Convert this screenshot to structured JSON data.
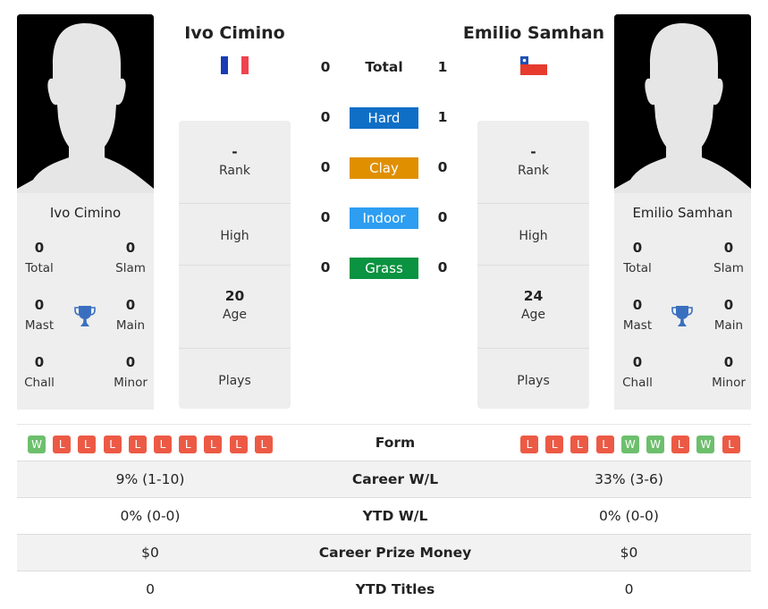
{
  "player1": {
    "name": "Ivo Cimino",
    "country_flag": "france-flag",
    "titles": {
      "total": {
        "value": "0",
        "label": "Total"
      },
      "slam": {
        "value": "0",
        "label": "Slam"
      },
      "mast": {
        "value": "0",
        "label": "Mast"
      },
      "main": {
        "value": "0",
        "label": "Main"
      },
      "chall": {
        "value": "0",
        "label": "Chall"
      },
      "minor": {
        "value": "0",
        "label": "Minor"
      }
    },
    "info": {
      "rank": {
        "value": "-",
        "label": "Rank"
      },
      "high": {
        "value": "",
        "label": "High"
      },
      "age": {
        "value": "20",
        "label": "Age"
      },
      "plays": {
        "value": "",
        "label": "Plays"
      }
    },
    "form": [
      "W",
      "L",
      "L",
      "L",
      "L",
      "L",
      "L",
      "L",
      "L",
      "L"
    ]
  },
  "player2": {
    "name": "Emilio Samhan",
    "country_flag": "chile-flag",
    "titles": {
      "total": {
        "value": "0",
        "label": "Total"
      },
      "slam": {
        "value": "0",
        "label": "Slam"
      },
      "mast": {
        "value": "0",
        "label": "Mast"
      },
      "main": {
        "value": "0",
        "label": "Main"
      },
      "chall": {
        "value": "0",
        "label": "Chall"
      },
      "minor": {
        "value": "0",
        "label": "Minor"
      }
    },
    "info": {
      "rank": {
        "value": "-",
        "label": "Rank"
      },
      "high": {
        "value": "",
        "label": "High"
      },
      "age": {
        "value": "24",
        "label": "Age"
      },
      "plays": {
        "value": "",
        "label": "Plays"
      }
    },
    "form": [
      "L",
      "L",
      "L",
      "L",
      "W",
      "W",
      "L",
      "W",
      "L"
    ]
  },
  "h2h": {
    "total": {
      "label": "Total",
      "p1": "0",
      "p2": "1"
    },
    "surfaces": [
      {
        "label": "Hard",
        "p1": "0",
        "p2": "1",
        "color": "#0f6fc6"
      },
      {
        "label": "Clay",
        "p1": "0",
        "p2": "0",
        "color": "#e08f00"
      },
      {
        "label": "Indoor",
        "p1": "0",
        "p2": "0",
        "color": "#2d9ef1"
      },
      {
        "label": "Grass",
        "p1": "0",
        "p2": "0",
        "color": "#0a9340"
      }
    ]
  },
  "form_label": "Form",
  "stats": [
    {
      "label": "Career W/L",
      "p1": "9% (1-10)",
      "p2": "33% (3-6)"
    },
    {
      "label": "YTD W/L",
      "p1": "0% (0-0)",
      "p2": "0% (0-0)"
    },
    {
      "label": "Career Prize Money",
      "p1": "$0",
      "p2": "$0"
    },
    {
      "label": "YTD Titles",
      "p1": "0",
      "p2": "0"
    }
  ]
}
